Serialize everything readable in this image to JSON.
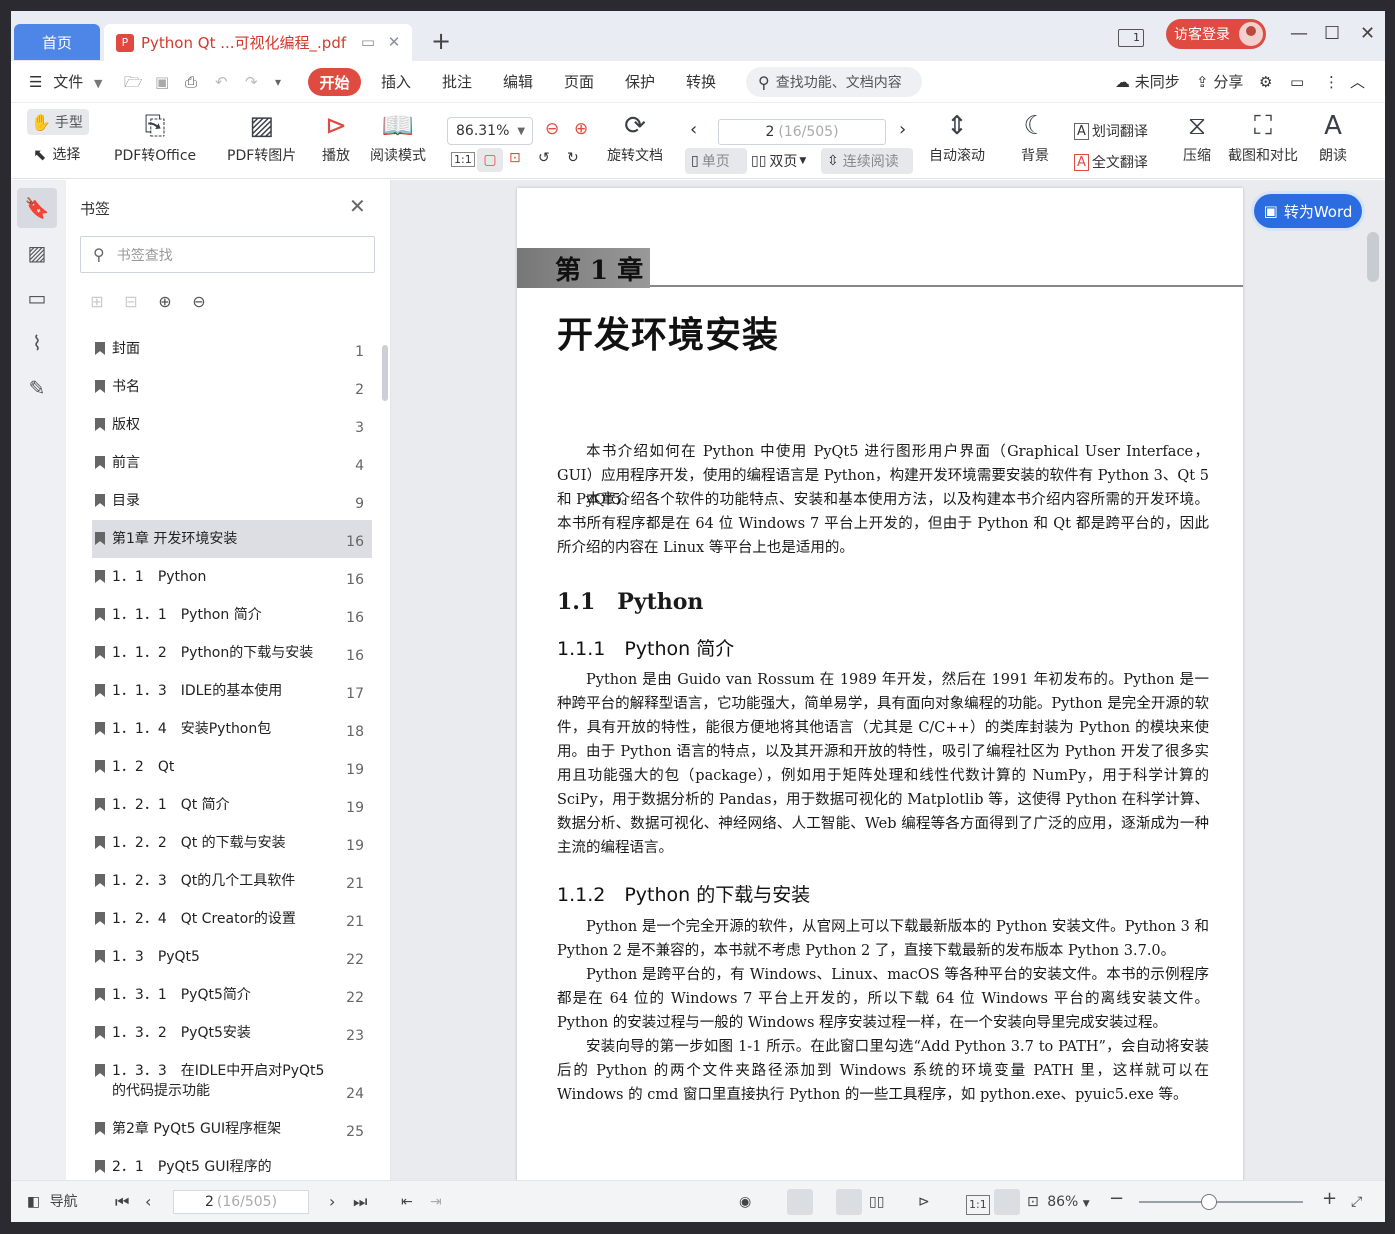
{
  "tabs": {
    "home": "首页",
    "doc_title": "Python Qt ...可视化编程_.pdf",
    "pdf_badge": "P",
    "add": "+"
  },
  "titlebar": {
    "login": "访客登录",
    "minimize": "—",
    "maximize": "☐",
    "close": "✕",
    "layout_icon": "1"
  },
  "menu": {
    "file": "文件",
    "start": "开始",
    "insert": "插入",
    "annotate": "批注",
    "edit": "编辑",
    "page": "页面",
    "protect": "保护",
    "convert": "转换",
    "search": "查找功能、文档内容",
    "sync": "未同步",
    "share": "分享"
  },
  "toolbar": {
    "hand": "手型",
    "select": "选择",
    "pdf_to_office": "PDF转Office",
    "pdf_to_image": "PDF转图片",
    "play": "播放",
    "read_mode": "阅读模式",
    "zoom": "86.31%",
    "rotate": "旋转文档",
    "page_current": "2",
    "page_total": "(16/505)",
    "single": "单页",
    "double": "双页",
    "continuous": "连续阅读",
    "auto_scroll": "自动滚动",
    "background": "背景",
    "word_translate": "划词翻译",
    "full_translate": "全文翻译",
    "compress": "压缩",
    "screenshot": "截图和对比",
    "read_aloud": "朗读",
    "actual_size": "1:1"
  },
  "panel": {
    "title": "书签",
    "search_placeholder": "书签查找",
    "items": [
      {
        "label": "封面",
        "page": "1"
      },
      {
        "label": "书名",
        "page": "2"
      },
      {
        "label": "版权",
        "page": "3"
      },
      {
        "label": "前言",
        "page": "4"
      },
      {
        "label": "目录",
        "page": "9"
      },
      {
        "label": "第1章 开发环境安装",
        "page": "16"
      },
      {
        "label": "1．1　Python",
        "page": "16"
      },
      {
        "label": "1．1．1　Python 简介",
        "page": "16"
      },
      {
        "label": "1．1．2　Python的下载与安装",
        "page": "16"
      },
      {
        "label": "1．1．3　IDLE的基本使用",
        "page": "17"
      },
      {
        "label": "1．1．4　安装Python包",
        "page": "18"
      },
      {
        "label": "1．2　Qt",
        "page": "19"
      },
      {
        "label": "1．2．1　Qt 简介",
        "page": "19"
      },
      {
        "label": "1．2．2　Qt 的下载与安装",
        "page": "19"
      },
      {
        "label": "1．2．3　Qt的几个工具软件",
        "page": "21"
      },
      {
        "label": "1．2．4　Qt Creator的设置",
        "page": "21"
      },
      {
        "label": "1．3　PyQt5",
        "page": "22"
      },
      {
        "label": "1．3．1　PyQt5简介",
        "page": "22"
      },
      {
        "label": "1．3．2　PyQt5安装",
        "page": "23"
      },
      {
        "label": "1．3．3　在IDLE中开启对PyQt5的代码提示功能",
        "page": "24"
      },
      {
        "label": "第2章 PyQt5 GUI程序框架",
        "page": "25"
      },
      {
        "label": "2．1　PyQt5 GUI程序的",
        "page": ""
      }
    ]
  },
  "document": {
    "to_word": "转为Word",
    "chapter_label": "第 1 章",
    "chapter_title": "开发环境安装",
    "intro1": "本书介绍如何在 Python 中使用 PyQt5 进行图形用户界面（Graphical User Interface，GUI）应用程序开发，使用的编程语言是 Python，构建开发环境需要安装的软件有 Python 3、Qt 5 和 PyQt5。",
    "intro2": "本章介绍各个软件的功能特点、安装和基本使用方法，以及构建本书介绍内容所需的开发环境。本书所有程序都是在 64 位 Windows 7 平台上开发的，但由于 Python 和 Qt 都是跨平台的，因此所介绍的内容在 Linux 等平台上也是适用的。",
    "s11": "1.1　Python",
    "s111": "1.1.1　Python 简介",
    "p111a": "Python 是由 Guido van Rossum 在 1989 年开发，然后在 1991 年初发布的。Python 是一种跨平台的解释型语言，它功能强大，简单易学，具有面向对象编程的功能。Python 是完全开源的软件，具有开放的特性，能很方便地将其他语言（尤其是 C/C++）的类库封装为 Python 的模块来使用。",
    "p111b": "由于 Python 语言的特点，以及其开源和开放的特性，吸引了编程社区为 Python 开发了很多实用且功能强大的包（package），例如用于矩阵处理和线性代数计算的 NumPy，用于科学计算的 SciPy，用于数据分析的 Pandas，用于数据可视化的 Matplotlib 等，这使得 Python 在科学计算、数据分析、数据可视化、神经网络、人工智能、Web 编程等各方面得到了广泛的应用，逐渐成为一种主流的编程语言。",
    "s112": "1.1.2　Python 的下载与安装",
    "p112a": "Python 是一个完全开源的软件，从官网上可以下载最新版本的 Python 安装文件。Python 3 和 Python 2 是不兼容的，本书就不考虑 Python 2 了，直接下载最新的发布版本 Python 3.7.0。",
    "p112b": "Python 是跨平台的，有 Windows、Linux、macOS 等各种平台的安装文件。本书的示例程序都是在 64 位的 Windows 7 平台上开发的，所以下载 64 位 Windows 平台的离线安装文件。Python 的安装过程与一般的 Windows 程序安装过程一样，在一个安装向导里完成安装过程。",
    "p112c": "安装向导的第一步如图 1-1 所示。在此窗口里勾选“Add Python 3.7 to PATH”，会自动将安装后的 Python 的两个文件夹路径添加到 Windows 系统的环境变量 PATH 里，这样就可以在 Windows 的 cmd 窗口里直接执行 Python 的一些工具程序，如 python.exe、pyuic5.exe 等。"
  },
  "status": {
    "nav": "导航",
    "page_current": "2",
    "page_total": "(16/505)",
    "zoom": "86%"
  },
  "colors": {
    "accent_red": "#e04b41",
    "accent_blue": "#2b6de0",
    "home_tab": "#4d86e6"
  }
}
